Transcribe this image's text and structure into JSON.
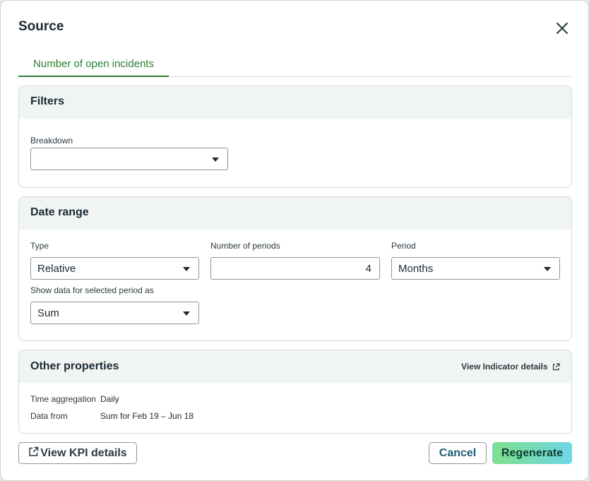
{
  "dialog": {
    "title": "Source",
    "close_icon": "close-icon"
  },
  "tabs": [
    {
      "label": "Number of open incidents",
      "active": true
    }
  ],
  "filters": {
    "title": "Filters",
    "breakdown_label": "Breakdown",
    "breakdown_value": ""
  },
  "date_range": {
    "title": "Date range",
    "type_label": "Type",
    "type_value": "Relative",
    "periods_label": "Number of periods",
    "periods_value": "4",
    "period_label": "Period",
    "period_value": "Months",
    "show_as_label": "Show data for selected period as",
    "show_as_value": "Sum"
  },
  "other": {
    "title": "Other properties",
    "link": "View Indicator details",
    "props": [
      {
        "label": "Time aggregation",
        "value": "Daily"
      },
      {
        "label": "Data from",
        "value": "Sum for Feb 19 – Jun 18"
      }
    ]
  },
  "footer": {
    "kpi_label": "View KPI details",
    "cancel_label": "Cancel",
    "regenerate_label": "Regenerate"
  },
  "colors": {
    "accent_green": "#2e7d32",
    "header_bg": "#f0f4f3",
    "regen_gradient_start": "#7fe08a",
    "regen_gradient_end": "#6fd6e6"
  }
}
